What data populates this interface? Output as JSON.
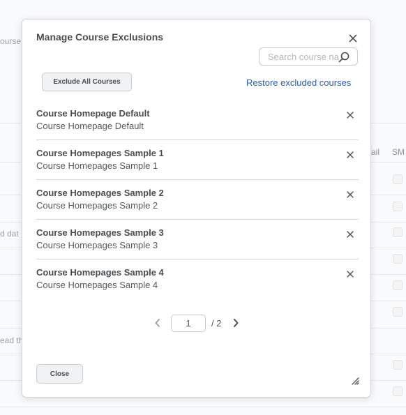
{
  "background": {
    "fragments": [
      "ourse",
      "ail",
      "SM",
      "d dat",
      "ead th"
    ]
  },
  "modal": {
    "title": "Manage Course Exclusions",
    "close_icon": "close-icon",
    "search": {
      "placeholder": "Search course na",
      "value": "",
      "icon": "search-icon"
    },
    "exclude_all_label": "Exclude All Courses",
    "restore_label": "Restore excluded courses",
    "courses": [
      {
        "title": "Course Homepage Default",
        "subtitle": "Course Homepage Default"
      },
      {
        "title": "Course Homepages Sample 1",
        "subtitle": "Course Homepages Sample 1"
      },
      {
        "title": "Course Homepages Sample 2",
        "subtitle": "Course Homepages Sample 2"
      },
      {
        "title": "Course Homepages Sample 3",
        "subtitle": "Course Homepages Sample 3"
      },
      {
        "title": "Course Homepages Sample 4",
        "subtitle": "Course Homepages Sample 4"
      }
    ],
    "pager": {
      "current_page": "1",
      "total_label": "/ 2"
    },
    "close_label": "Close"
  }
}
